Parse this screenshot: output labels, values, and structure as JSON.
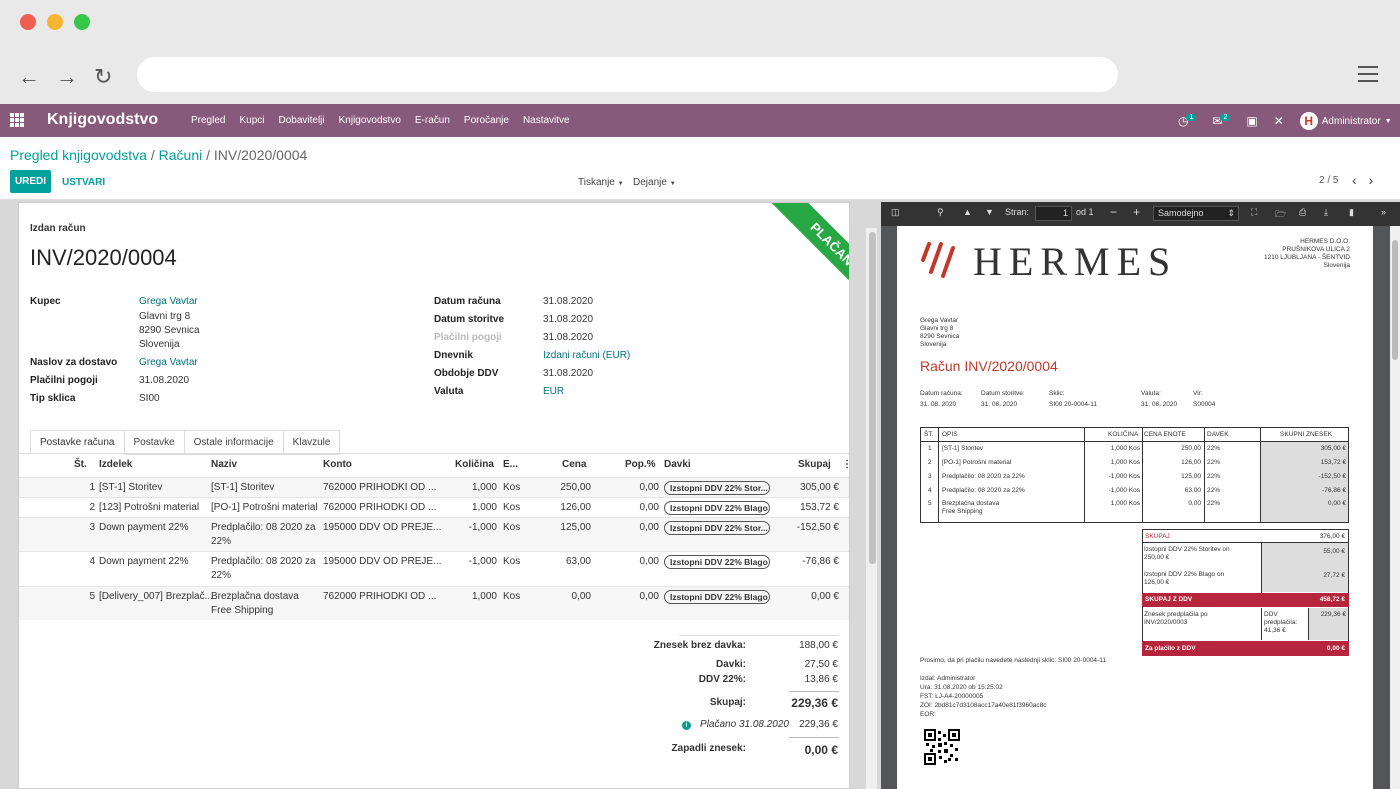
{
  "colors": {
    "brand": "#875a7b",
    "accent": "#00a09d",
    "paid": "#28a745",
    "pdf_red": "#b5263c"
  },
  "topbar": {
    "app": "Knjigovodstvo",
    "menu": [
      "Pregled",
      "Kupci",
      "Dobavitelji",
      "Knjigovodstvo",
      "E-račun",
      "Poročanje",
      "Nastavitve"
    ],
    "activity_count": "1",
    "msg_count": "2",
    "user": "Administrator"
  },
  "breadcrumb": {
    "a": "Pregled knjigovodstva",
    "b": "Računi",
    "c": "INV/2020/0004",
    "sep": "/"
  },
  "buttons": {
    "edit": "UREDI",
    "create": "USTVARI",
    "print": "Tiskanje",
    "action": "Dejanje"
  },
  "pager": "2 / 5",
  "invoice": {
    "type_label": "Izdan račun",
    "number": "INV/2020/0004",
    "status": "PLAČANO",
    "left": [
      {
        "label": "Kupec",
        "lines": [
          "Grega Vavtar",
          "Glavni trg 8",
          "8290 Sevnica",
          "Slovenija"
        ]
      },
      {
        "label": "Naslov za dostavo",
        "lines": [
          "Grega Vavtar"
        ]
      },
      {
        "label": "Plačilni pogoji",
        "lines": [
          "31.08.2020"
        ]
      },
      {
        "label": "Tip sklica",
        "lines": [
          "SI00"
        ]
      }
    ],
    "right": [
      {
        "label": "Datum računa",
        "value": "31.08.2020"
      },
      {
        "label": "Datum storitve",
        "value": "31.08.2020"
      },
      {
        "label": "Plačilni pogoji",
        "value": "31.08.2020"
      },
      {
        "label": "Dnevnik",
        "value": "Izdani računi (EUR)"
      },
      {
        "label": "Obdobje DDV",
        "value": "31.08.2020"
      },
      {
        "label": "Valuta",
        "value": "EUR"
      }
    ]
  },
  "tabs": [
    "Postavke računa",
    "Postavke",
    "Ostale informacije",
    "Klavzule"
  ],
  "table": {
    "headers": [
      "Št.",
      "Izdelek",
      "Naziv",
      "Konto",
      "Količina",
      "E...",
      "Cena",
      "Pop.%",
      "Davki",
      "Skupaj"
    ],
    "rows": [
      {
        "n": "1",
        "product": "[ST-1] Storitev",
        "name": [
          "[ST-1] Storitev"
        ],
        "account": "762000 PRIHODKI OD ...",
        "qty": "1,000",
        "uom": "Kos",
        "price": "250,00",
        "disc": "0,00",
        "tax": "Izstopni DDV 22% Stor...",
        "total": "305,00 €"
      },
      {
        "n": "2",
        "product": "[123] Potrošni material",
        "name": [
          "[PO-1] Potrošni material"
        ],
        "account": "762000 PRIHODKI OD ...",
        "qty": "1,000",
        "uom": "Kos",
        "price": "126,00",
        "disc": "0,00",
        "tax": "Izstopni DDV 22% Blago",
        "total": "153,72 €"
      },
      {
        "n": "3",
        "product": "Down payment 22%",
        "name": [
          "Predplačilo: 08 2020 za",
          "22%"
        ],
        "account": "195000 DDV OD PREJE...",
        "qty": "-1,000",
        "uom": "Kos",
        "price": "125,00",
        "disc": "0,00",
        "tax": "Izstopni DDV 22% Stor...",
        "total": "-152,50 €"
      },
      {
        "n": "4",
        "product": "Down payment 22%",
        "name": [
          "Predplačilo: 08 2020 za",
          "22%"
        ],
        "account": "195000 DDV OD PREJE...",
        "qty": "-1,000",
        "uom": "Kos",
        "price": "63,00",
        "disc": "0,00",
        "tax": "Izstopni DDV 22% Blago",
        "total": "-76,86 €"
      },
      {
        "n": "5",
        "product": "[Delivery_007] Brezplač...",
        "name": [
          "Brezplačna dostava",
          "Free Shipping"
        ],
        "account": "762000 PRIHODKI OD ...",
        "qty": "1,000",
        "uom": "Kos",
        "price": "0,00",
        "disc": "0,00",
        "tax": "Izstopni DDV 22% Blago",
        "total": "0,00 €"
      }
    ]
  },
  "totals": {
    "untaxed_label": "Znesek brez davka:",
    "untaxed": "188,00 €",
    "taxes_label": "Davki:",
    "taxes": "27,50 €",
    "vat_label": "DDV 22%:",
    "vat": "13,86 €",
    "total_label": "Skupaj:",
    "total": "229,36 €",
    "paid_label": "Plačano 31.08.2020",
    "paid": "229,36 €",
    "due_label": "Zapadli znesek:",
    "due": "0,00 €"
  },
  "pdf": {
    "page_label": "Stran:",
    "page": "1",
    "of": "od 1",
    "zoom": "Samodejno",
    "company": [
      "HERMES D.O.O.",
      "PRUŠNIKOVA ULICA 2",
      "1210 LJUBLJANA - ŠENTVID",
      "Slovenija"
    ],
    "logo": "HERMES",
    "customer": [
      "Grega Vavtar",
      "Glavni trg 8",
      "8290 Sevnica",
      "Slovenija"
    ],
    "title": "Račun INV/2020/0004",
    "meta": [
      {
        "label": "Datum računa:",
        "value": "31. 08. 2020"
      },
      {
        "label": "Datum storitve:",
        "value": "31. 08. 2020"
      },
      {
        "label": "Sklic:",
        "value": "SI00 20-0004-11"
      },
      {
        "label": "Valuta:",
        "value": "31. 08. 2020"
      },
      {
        "label": "Vir:",
        "value": "S00004"
      }
    ],
    "headers": [
      "ŠT.",
      "OPIS",
      "KOLIČINA",
      "CENA ENOTE",
      "DAVEK",
      "SKUPNI ZNESEK"
    ],
    "rows": [
      {
        "n": "1",
        "desc": [
          "[ST-1] Storitev"
        ],
        "qty": "1,000 Kos",
        "price": "250,00",
        "tax": "22%",
        "total": "305,00 €"
      },
      {
        "n": "2",
        "desc": [
          "[PO-1] Potrošni material"
        ],
        "qty": "1,000 Kos",
        "price": "126,00",
        "tax": "22%",
        "total": "153,72 €"
      },
      {
        "n": "3",
        "desc": [
          "Predplačilo: 08 2020 za 22%"
        ],
        "qty": "-1,000 Kos",
        "price": "125,00",
        "tax": "22%",
        "total": "-152,50 €"
      },
      {
        "n": "4",
        "desc": [
          "Predplačilo: 08 2020 za 22%"
        ],
        "qty": "-1,000 Kos",
        "price": "63,00",
        "tax": "22%",
        "total": "-76,86 €"
      },
      {
        "n": "5",
        "desc": [
          "Brezplačna dostava",
          "Free Shipping"
        ],
        "qty": "1,000 Kos",
        "price": "0,00",
        "tax": "22%",
        "total": "0,00 €"
      }
    ],
    "sum_label": "SKUPAJ",
    "sum": "376,00 €",
    "tax1": [
      "Izstopni DDV 22% Storitev    on",
      "250,00 €"
    ],
    "tax1_val": "55,00 €",
    "tax2": [
      "Izstopni DDV 22% Blago    on",
      "126,00 €"
    ],
    "tax2_val": "27,72 €",
    "gross_label": "SKUPAJ Z DDV",
    "gross": "458,72 €",
    "dp": [
      "Znesek predplačila po",
      "INV/2020/0003"
    ],
    "dp_mid": [
      "DDV",
      "predplačila:",
      "41,36 €"
    ],
    "dp_val": "229,36 €",
    "pay_label": "Za plačilo z DDV",
    "pay": "0,00 €",
    "note": "Prosimo, da pri plačilu navedete naslednji sklic: SI00 20-0004-11",
    "footer": [
      "Izdal: Administrator",
      "Ura: 31.08.2020 ob 15:25:02",
      "FST: LJ-A4-20000005",
      "ZOI: 2bd81c7d3108acc17a40e81f3960ac8c",
      "EOR:"
    ]
  }
}
